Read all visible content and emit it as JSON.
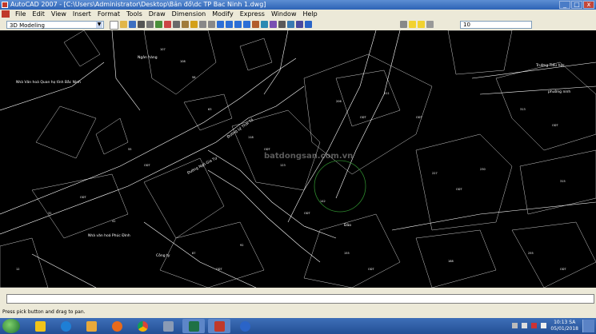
{
  "window": {
    "title": "AutoCAD 2007 - [C:\\Users\\Administrator\\Desktop\\Bản đồ\\dc TP Bac Ninh 1.dwg]"
  },
  "menu": [
    "File",
    "Edit",
    "View",
    "Insert",
    "Format",
    "Tools",
    "Draw",
    "Dimension",
    "Modify",
    "Express",
    "Window",
    "Help"
  ],
  "toolbar": {
    "workspace": "3D Modeling",
    "layer": "10"
  },
  "drawing": {
    "labels": [
      {
        "text": "Ngân hàng",
        "name": "map-label-bank"
      },
      {
        "text": "Nhà Văn hoá Quan họ tỉnh Bắc Ninh",
        "name": "map-label-culture-house"
      },
      {
        "text": "Trường Tiểu học",
        "name": "map-label-primary-school"
      },
      {
        "text": "phường ninh",
        "name": "map-label-ward"
      },
      {
        "text": "Đảo",
        "name": "map-label-island"
      },
      {
        "text": "Nhà văn hoá Phúc Đình",
        "name": "map-label-culture-house-2"
      },
      {
        "text": "Công ty",
        "name": "map-label-company"
      },
      {
        "text": "Đường Ngô Gia Tự",
        "name": "map-label-street-1"
      },
      {
        "text": "Đường Lý Thái Tổ",
        "name": "map-label-street-2"
      }
    ],
    "watermark": "batdongsan.com.vn"
  },
  "status": {
    "prompt": "Press pick button and drag to pan."
  },
  "taskbar": {
    "apps": [
      "explorer",
      "ie",
      "folder",
      "media-player",
      "chrome",
      "calculator",
      "excel",
      "autocad",
      "help"
    ],
    "time": "10:13 SA",
    "date": "05/01/2018"
  },
  "colors": {
    "drawing_bg": "#000000",
    "lines": "#ffffff",
    "circle": "#2e8b2e",
    "menu_bg": "#ece9d8",
    "taskbar": "#2d5aa5"
  }
}
